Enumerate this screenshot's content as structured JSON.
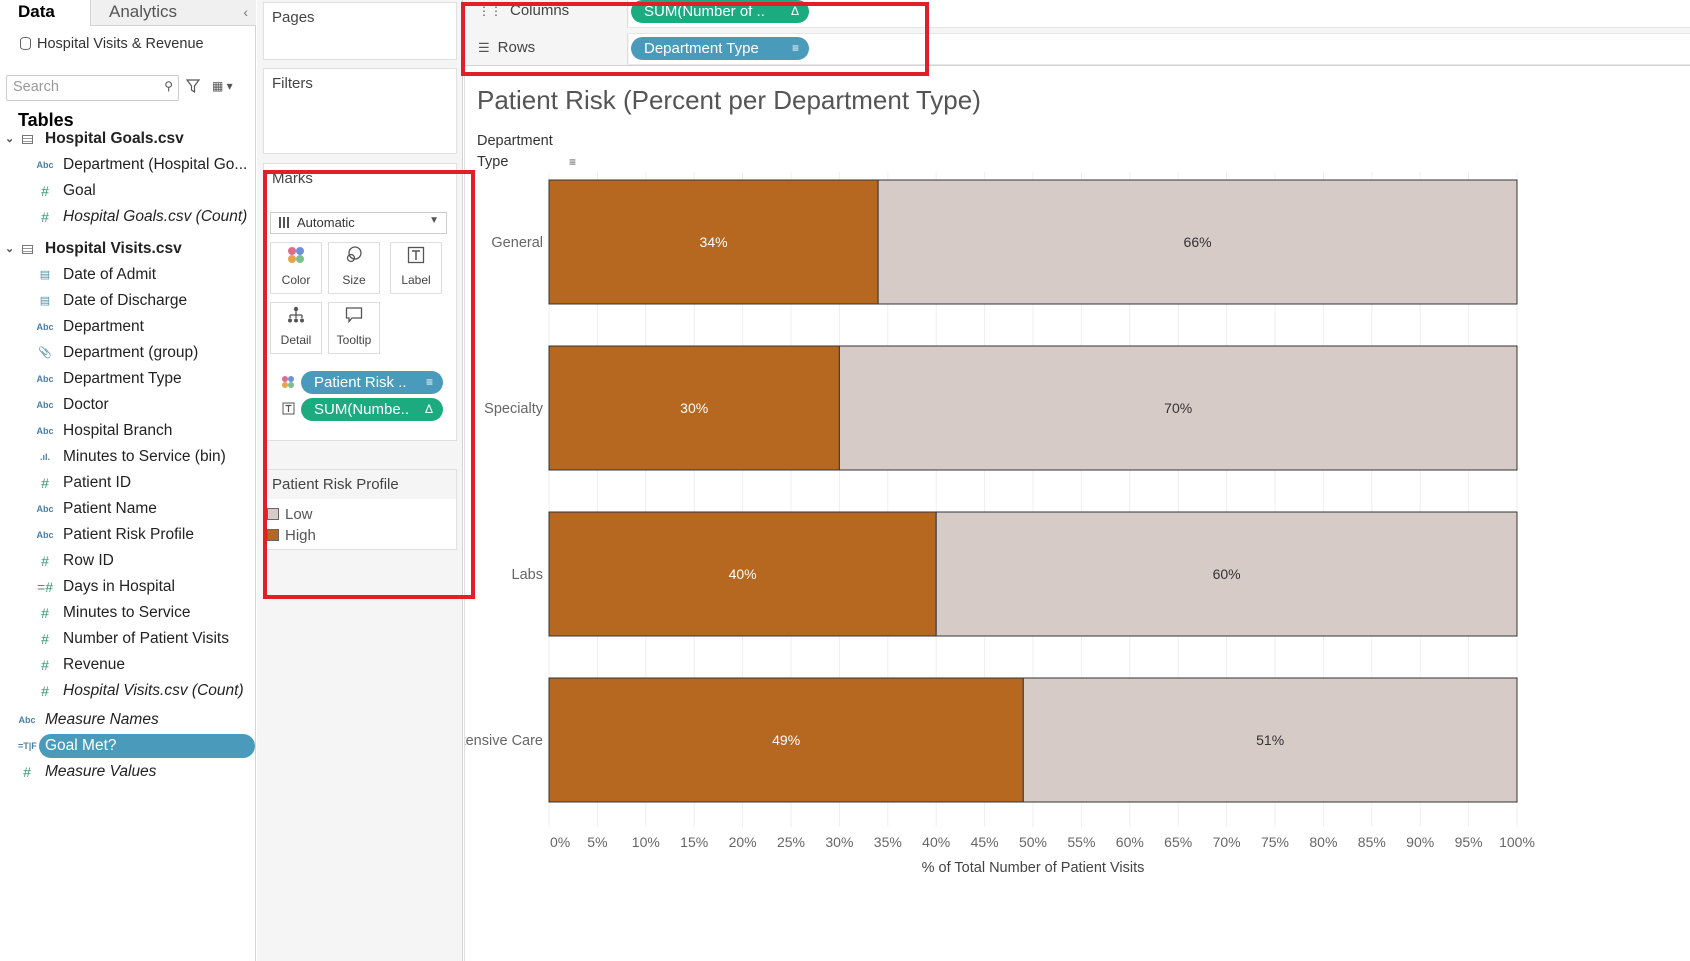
{
  "data_pane": {
    "tab_data": "Data",
    "tab_analytics": "Analytics",
    "collapse_glyph": "‹",
    "datasource": "Hospital Visits & Revenue",
    "search_placeholder": "Search",
    "tables_title": "Tables",
    "tables": [
      {
        "name": "Hospital Goals.csv",
        "fields": [
          {
            "icon": "abc-icon",
            "label": "Department (Hospital Go...",
            "italic": false
          },
          {
            "icon": "measure-icon",
            "label": "Goal",
            "italic": false
          },
          {
            "icon": "measure-icon",
            "label": "Hospital Goals.csv (Count)",
            "italic": true
          }
        ]
      },
      {
        "name": "Hospital Visits.csv",
        "fields": [
          {
            "icon": "calendar-icon",
            "label": "Date of Admit",
            "italic": false
          },
          {
            "icon": "calendar-icon",
            "label": "Date of Discharge",
            "italic": false
          },
          {
            "icon": "abc-icon",
            "label": "Department",
            "italic": false
          },
          {
            "icon": "paperclip-icon",
            "label": "Department (group)",
            "italic": false
          },
          {
            "icon": "abc-icon",
            "label": "Department Type",
            "italic": false
          },
          {
            "icon": "abc-icon",
            "label": "Doctor",
            "italic": false
          },
          {
            "icon": "abc-icon",
            "label": "Hospital Branch",
            "italic": false
          },
          {
            "icon": "bin-icon",
            "label": "Minutes to Service (bin)",
            "italic": false
          },
          {
            "icon": "measure-icon",
            "label": "Patient ID",
            "italic": false
          },
          {
            "icon": "abc-icon",
            "label": "Patient Name",
            "italic": false
          },
          {
            "icon": "abc-icon",
            "label": "Patient Risk Profile",
            "italic": false
          },
          {
            "icon": "measure-icon",
            "label": "Row ID",
            "italic": false
          },
          {
            "icon": "calc-measure-icon",
            "label": "Days in Hospital",
            "italic": false
          },
          {
            "icon": "measure-icon",
            "label": "Minutes to Service",
            "italic": false
          },
          {
            "icon": "measure-icon",
            "label": "Number of Patient Visits",
            "italic": false
          },
          {
            "icon": "measure-icon",
            "label": "Revenue",
            "italic": false
          },
          {
            "icon": "measure-icon",
            "label": "Hospital Visits.csv (Count)",
            "italic": true
          }
        ]
      }
    ],
    "loose_fields": [
      {
        "icon": "abc-icon",
        "label": "Measure Names",
        "italic": true
      },
      {
        "icon": "tf-icon",
        "label": "Goal Met?",
        "italic": false,
        "selected": true
      },
      {
        "icon": "measure-icon",
        "label": "Measure Values",
        "italic": true
      }
    ]
  },
  "cards": {
    "pages_title": "Pages",
    "filters_title": "Filters",
    "marks_title": "Marks",
    "mark_type": "Automatic",
    "mark_buttons": [
      {
        "label": "Color",
        "icon": "color-icon"
      },
      {
        "label": "Size",
        "icon": "size-icon"
      },
      {
        "label": "Label",
        "icon": "label-icon"
      },
      {
        "label": "Detail",
        "icon": "detail-icon"
      },
      {
        "label": "Tooltip",
        "icon": "tooltip-icon"
      }
    ],
    "mark_pills": [
      {
        "text": "Patient Risk ..",
        "kind": "dimension",
        "encoding": "color"
      },
      {
        "text": "SUM(Numbe..",
        "kind": "measure",
        "encoding": "label"
      }
    ],
    "legend_title": "Patient Risk Profile",
    "legend": [
      {
        "label": "Low",
        "color": "#d7cbc7"
      },
      {
        "label": "High",
        "color": "#b66820"
      }
    ]
  },
  "shelves": {
    "columns_label": "Columns",
    "columns_pill": "SUM(Number of ..",
    "rows_label": "Rows",
    "rows_pill": "Department Type"
  },
  "colors": {
    "high": "#b66820",
    "low": "#d7cbc7",
    "highlight": "#e21f26",
    "pill_blue": "#4a9bbb",
    "pill_green": "#1bab7f"
  },
  "chart_data": {
    "type": "bar",
    "orientation": "horizontal",
    "stacked": true,
    "title": "Patient Risk (Percent per Department Type)",
    "row_header": "Department Type",
    "xlabel": "% of Total Number of Patient Visits",
    "categories": [
      "General",
      "Specialty",
      "Labs",
      "Intensive Care"
    ],
    "series": [
      {
        "name": "High",
        "values": [
          34,
          30,
          40,
          49
        ],
        "labels": [
          "34%",
          "30%",
          "40%",
          "49%"
        ]
      },
      {
        "name": "Low",
        "values": [
          66,
          70,
          60,
          51
        ],
        "labels": [
          "66%",
          "70%",
          "60%",
          "51%"
        ]
      }
    ],
    "xlim": [
      0,
      100
    ],
    "xticks": [
      "0%",
      "5%",
      "10%",
      "15%",
      "20%",
      "25%",
      "30%",
      "35%",
      "40%",
      "45%",
      "50%",
      "55%",
      "60%",
      "65%",
      "70%",
      "75%",
      "80%",
      "85%",
      "90%",
      "95%",
      "100%"
    ],
    "grid": true
  }
}
